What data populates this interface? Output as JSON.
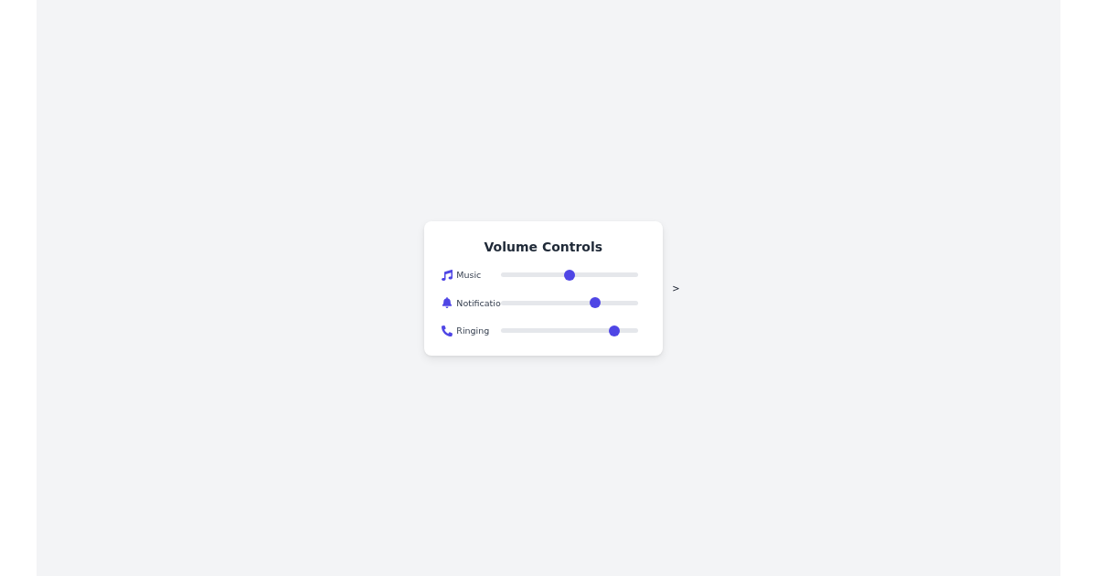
{
  "card": {
    "title": "Volume Controls",
    "channels": [
      {
        "kind": "music",
        "label": "Music",
        "level": 0.5
      },
      {
        "kind": "notification",
        "label": "Notificatio",
        "level": 0.7
      },
      {
        "kind": "ringing",
        "label": "Ringing",
        "level": 0.85
      }
    ]
  },
  "next_glyph": ">"
}
